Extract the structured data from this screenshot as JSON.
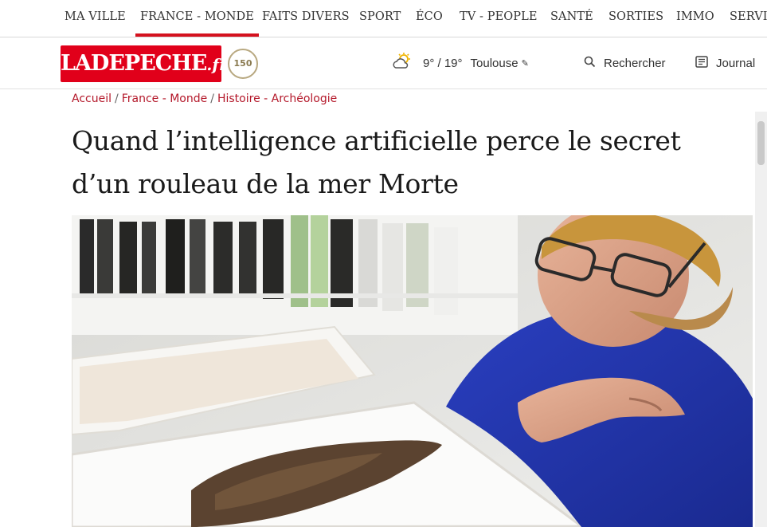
{
  "topnav": {
    "items": [
      {
        "label": "MA VILLE",
        "active": false
      },
      {
        "label": "FRANCE - MONDE",
        "active": true
      },
      {
        "label": "FAITS DIVERS",
        "active": false
      },
      {
        "label": "SPORT",
        "active": false
      },
      {
        "label": "ÉCO",
        "active": false
      },
      {
        "label": "TV - PEOPLE",
        "active": false
      },
      {
        "label": "SANTÉ",
        "active": false
      },
      {
        "label": "SORTIES",
        "active": false
      },
      {
        "label": "IMMO",
        "active": false
      },
      {
        "label": "SERVICES",
        "active": false
      }
    ],
    "accent_color": "#d4111e"
  },
  "header": {
    "logo_main": "LADEPECHE",
    "logo_suffix": ".fr",
    "anniversary_badge": "150",
    "weather": {
      "icon": "partly-cloudy-icon",
      "temp": "9° / 19°",
      "city": "Toulouse"
    },
    "search_label": "Rechercher",
    "journal_label": "Journal"
  },
  "breadcrumb": {
    "items": [
      "Accueil",
      "France - Monde",
      "Histoire - Archéologie"
    ],
    "separator": "/"
  },
  "article": {
    "title": "Quand l’intelligence artificielle perce le secret d’un rouleau de la mer Morte"
  },
  "colors": {
    "brand_red": "#e1001a",
    "breadcrumb_red": "#b4182a"
  }
}
